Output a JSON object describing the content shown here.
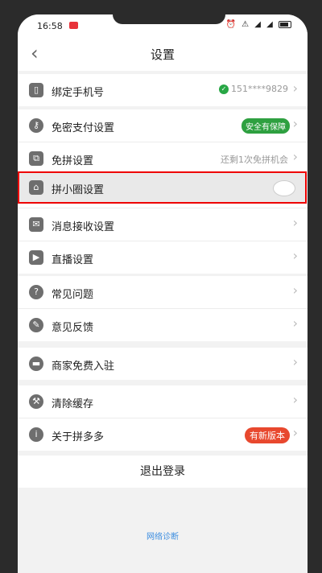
{
  "status": {
    "time": "16:58",
    "icons": "⏰ ⚠ ◢ ◢"
  },
  "nav": {
    "title": "设置",
    "back": "‹"
  },
  "groups": {
    "account": {
      "phone_label": "绑定手机号",
      "phone_value": "151****9829"
    },
    "pay": {
      "free_pay_label": "免密支付设置",
      "free_pay_badge": "安全有保障",
      "free_group_label": "免拼设置",
      "free_group_value": "还剩1次免拼机会",
      "circle_label": "拼小圈设置",
      "msg_label": "消息接收设置",
      "live_label": "直播设置"
    },
    "help": {
      "faq_label": "常见问题",
      "feedback_label": "意见反馈"
    },
    "merchant": {
      "label": "商家免费入驻"
    },
    "misc": {
      "cache_label": "清除缓存",
      "about_label": "关于拼多多",
      "about_badge": "有新版本"
    }
  },
  "logout": "退出登录",
  "diagnose": "网络诊断"
}
